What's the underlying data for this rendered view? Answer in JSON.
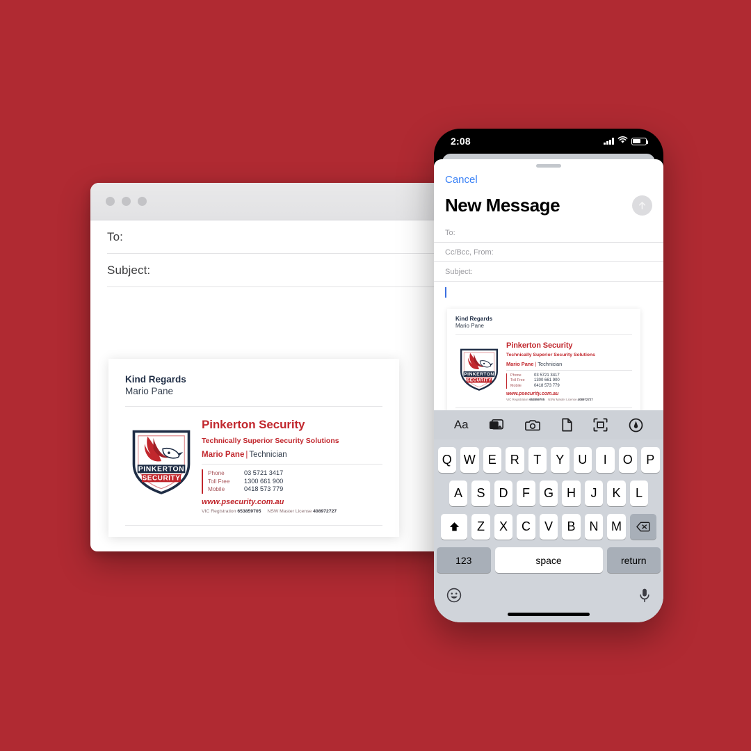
{
  "theme": {
    "background": "#B02A32",
    "brand_red": "#C1272D",
    "brand_navy": "#1F2D45",
    "ios_blue": "#3B82F6"
  },
  "desktop_window": {
    "traffic_lights": [
      "close",
      "minimize",
      "zoom"
    ],
    "fields": [
      {
        "label": "To:"
      },
      {
        "label": "Subject:"
      }
    ]
  },
  "phone": {
    "status_bar": {
      "time": "2:08",
      "cellular_icon": "signal-bars-icon",
      "wifi_icon": "wifi-icon",
      "battery_icon": "battery-icon"
    },
    "sheet": {
      "cancel_label": "Cancel",
      "title": "New Message",
      "send_icon": "send-arrow-up-icon"
    },
    "fields": [
      {
        "label": "To:"
      },
      {
        "label": "Cc/Bcc, From:"
      },
      {
        "label": "Subject:"
      }
    ],
    "keyboard": {
      "toolbar_icons": [
        "text-format-icon",
        "photos-icon",
        "camera-icon",
        "document-icon",
        "scan-document-icon",
        "markup-pen-icon"
      ],
      "toolbar_format_label": "Aa",
      "row1": [
        "Q",
        "W",
        "E",
        "R",
        "T",
        "Y",
        "U",
        "I",
        "O",
        "P"
      ],
      "row2": [
        "A",
        "S",
        "D",
        "F",
        "G",
        "H",
        "J",
        "K",
        "L"
      ],
      "row3_letters": [
        "Z",
        "X",
        "C",
        "V",
        "B",
        "N",
        "M"
      ],
      "shift_icon": "shift-arrow-up-icon",
      "backspace_icon": "backspace-delete-icon",
      "numbers_label": "123",
      "space_label": "space",
      "return_label": "return",
      "emoji_icon": "emoji-smiley-icon",
      "dictation_icon": "microphone-icon"
    }
  },
  "signature": {
    "greeting": "Kind Regards",
    "sender_name": "Mario Pane",
    "logo_icon": "pinkerton-security-shield-eagle-logo",
    "logo_text_top": "PINKERTON",
    "logo_text_bottom": "SECURITY",
    "company": "Pinkerton Security",
    "tagline": "Technically Superior Security Solutions",
    "person_name": "Mario Pane",
    "person_separator": "|",
    "person_title": "Technician",
    "contacts": [
      {
        "label": "Phone",
        "value": "03 5721 3417"
      },
      {
        "label": "Toll Free",
        "value": "1300 661 900"
      },
      {
        "label": "Mobile",
        "value": "0418 573 779"
      }
    ],
    "website": "www.psecurity.com.au",
    "legal": {
      "vic_label": "VIC Registration",
      "vic_number": "653859705",
      "nsw_label": "NSW Master License",
      "nsw_number": "408972727"
    }
  }
}
